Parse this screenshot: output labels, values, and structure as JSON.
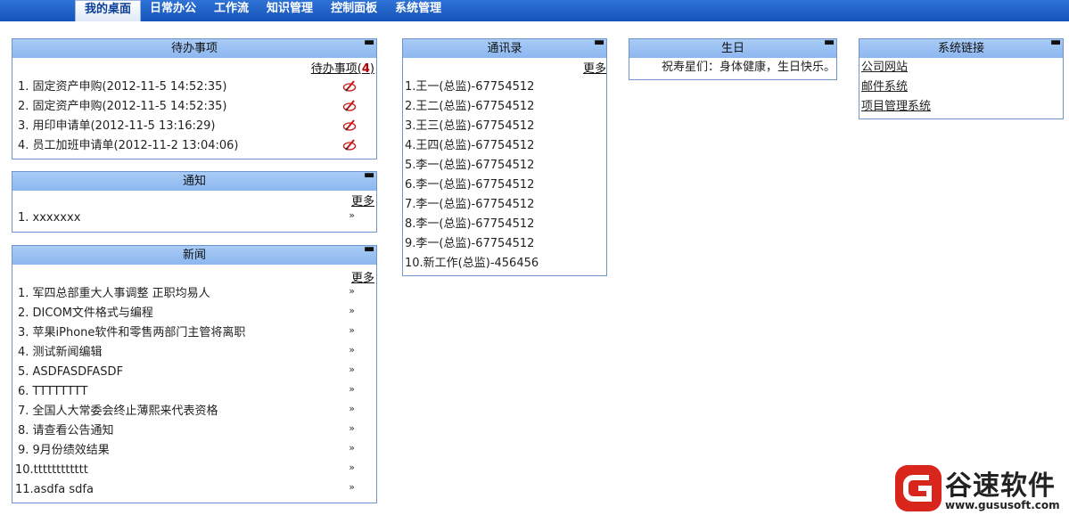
{
  "nav": {
    "items": [
      "我的桌面",
      "日常办公",
      "工作流",
      "知识管理",
      "控制面板",
      "系统管理"
    ],
    "active_index": 0
  },
  "todo": {
    "title": "待办事项",
    "more_label": "待办事项",
    "count": "4",
    "count_open": "(",
    "count_close": ")",
    "items": [
      "1. 固定资产申购(2012-11-5 14:52:35)",
      "2. 固定资产申购(2012-11-5 14:52:35)",
      "3. 用印申请单(2012-11-5 13:16:29)",
      "4. 员工加班申请单(2012-11-2 13:04:06)"
    ]
  },
  "notice": {
    "title": "通知",
    "more_label": "更多",
    "items": [
      "1. xxxxxxx"
    ]
  },
  "news": {
    "title": "新闻",
    "more_label": "更多",
    "items": [
      "1. 军四总部重大人事调整 正职均易人",
      "2. DICOM文件格式与编程",
      "3. 苹果iPhone软件和零售两部门主管将离职",
      "4. 测试新闻编辑",
      "5. ASDFASDFASDF",
      "6. TTTTTTTT",
      "7. 全国人大常委会终止薄熙来代表资格",
      "8. 请查看公告通知",
      "9. 9月份绩效结果",
      "10.tttttttttttt",
      "11.asdfa sdfa"
    ]
  },
  "contacts": {
    "title": "通讯录",
    "more_label": "更多",
    "items": [
      "1.王一(总监)-67754512",
      "2.王二(总监)-67754512",
      "3.王三(总监)-67754512",
      "4.王四(总监)-67754512",
      "5.李一(总监)-67754512",
      "6.李一(总监)-67754512",
      "7.李一(总监)-67754512",
      "8.李一(总监)-67754512",
      "9.李一(总监)-67754512",
      "10.新工作(总监)-456456"
    ]
  },
  "birthday": {
    "title": "生日",
    "text": "祝寿星们：身体健康，生日快乐。"
  },
  "links": {
    "title": "系统链接",
    "items": [
      "公司网站",
      "邮件系统",
      "项目管理系统"
    ]
  },
  "watermark": {
    "text": "谷速软件",
    "url": "www.gususoft.com"
  },
  "colors": {
    "nav_bg": "#1553b8",
    "panel_head": "#8cb7f0",
    "panel_border": "#6f95cf",
    "count": "#b10000",
    "logo_red": "#d9261c"
  }
}
